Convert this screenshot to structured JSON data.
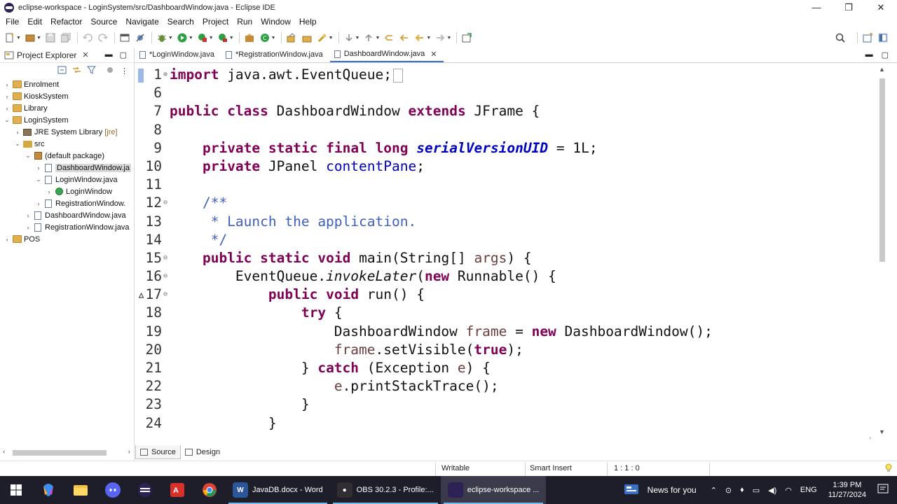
{
  "window": {
    "title": "eclipse-workspace - LoginSystem/src/DashboardWindow.java - Eclipse IDE",
    "minimize": "—",
    "maximize": "❐",
    "close": "✕"
  },
  "menu": [
    "File",
    "Edit",
    "Refactor",
    "Source",
    "Navigate",
    "Search",
    "Project",
    "Run",
    "Window",
    "Help"
  ],
  "explorer": {
    "title": "Project Explorer",
    "tree": [
      {
        "label": "Enrolment",
        "depth": 0,
        "arrow": "›",
        "icon": "project"
      },
      {
        "label": "KioskSystem",
        "depth": 0,
        "arrow": "›",
        "icon": "project"
      },
      {
        "label": "Library",
        "depth": 0,
        "arrow": "›",
        "icon": "project"
      },
      {
        "label": "LoginSystem",
        "depth": 0,
        "arrow": "⌄",
        "icon": "project"
      },
      {
        "label": "JRE System Library",
        "tag": "[jre]",
        "depth": 1,
        "arrow": "›",
        "icon": "jre"
      },
      {
        "label": "src",
        "depth": 1,
        "arrow": "⌄",
        "icon": "folder"
      },
      {
        "label": "(default package)",
        "depth": 2,
        "arrow": "⌄",
        "icon": "package"
      },
      {
        "label": "DashboardWindow.ja",
        "depth": 3,
        "arrow": "›",
        "icon": "java",
        "selected": true
      },
      {
        "label": "LoginWindow.java",
        "depth": 3,
        "arrow": "⌄",
        "icon": "java"
      },
      {
        "label": "LoginWindow",
        "depth": 4,
        "arrow": "›",
        "icon": "class"
      },
      {
        "label": "RegistrationWindow.",
        "depth": 3,
        "arrow": "›",
        "icon": "java"
      },
      {
        "label": "DashboardWindow.java",
        "depth": 2,
        "arrow": "›",
        "icon": "java"
      },
      {
        "label": "RegistrationWindow.java",
        "depth": 2,
        "arrow": "›",
        "icon": "java"
      },
      {
        "label": "POS",
        "depth": 0,
        "arrow": "›",
        "icon": "project"
      }
    ]
  },
  "editor": {
    "tabs": [
      {
        "label": "*LoginWindow.java",
        "active": false
      },
      {
        "label": "*RegistrationWindow.java",
        "active": false
      },
      {
        "label": "DashboardWindow.java",
        "active": true
      }
    ],
    "lines": [
      {
        "n": "1",
        "fold": "⊕",
        "tokens": [
          {
            "t": "import",
            "c": "kw"
          },
          {
            "t": " java.awt.EventQueue;",
            "c": ""
          }
        ],
        "caret": true
      },
      {
        "n": "6",
        "fold": "",
        "tokens": []
      },
      {
        "n": "7",
        "fold": "",
        "tokens": [
          {
            "t": "public",
            "c": "kw"
          },
          {
            "t": " ",
            "c": ""
          },
          {
            "t": "class",
            "c": "kw"
          },
          {
            "t": " DashboardWindow ",
            "c": ""
          },
          {
            "t": "extends",
            "c": "kw"
          },
          {
            "t": " JFrame {",
            "c": ""
          }
        ]
      },
      {
        "n": "8",
        "fold": "",
        "tokens": []
      },
      {
        "n": "9",
        "fold": "",
        "tokens": [
          {
            "t": "    ",
            "c": ""
          },
          {
            "t": "private",
            "c": "kw"
          },
          {
            "t": " ",
            "c": ""
          },
          {
            "t": "static",
            "c": "kw"
          },
          {
            "t": " ",
            "c": ""
          },
          {
            "t": "final",
            "c": "kw"
          },
          {
            "t": " ",
            "c": ""
          },
          {
            "t": "long",
            "c": "kw"
          },
          {
            "t": " ",
            "c": ""
          },
          {
            "t": "serialVersionUID",
            "c": "sfld"
          },
          {
            "t": " = 1L;",
            "c": ""
          }
        ]
      },
      {
        "n": "10",
        "fold": "",
        "tokens": [
          {
            "t": "    ",
            "c": ""
          },
          {
            "t": "private",
            "c": "kw"
          },
          {
            "t": " JPanel ",
            "c": ""
          },
          {
            "t": "contentPane",
            "c": "fld"
          },
          {
            "t": ";",
            "c": ""
          }
        ]
      },
      {
        "n": "11",
        "fold": "",
        "tokens": []
      },
      {
        "n": "12",
        "fold": "⊖",
        "tokens": [
          {
            "t": "    /**",
            "c": "cm"
          }
        ]
      },
      {
        "n": "13",
        "fold": "",
        "tokens": [
          {
            "t": "     * Launch the application.",
            "c": "cm"
          }
        ]
      },
      {
        "n": "14",
        "fold": "",
        "tokens": [
          {
            "t": "     */",
            "c": "cm"
          }
        ]
      },
      {
        "n": "15",
        "fold": "⊖",
        "tokens": [
          {
            "t": "    ",
            "c": ""
          },
          {
            "t": "public",
            "c": "kw"
          },
          {
            "t": " ",
            "c": ""
          },
          {
            "t": "static",
            "c": "kw"
          },
          {
            "t": " ",
            "c": ""
          },
          {
            "t": "void",
            "c": "kw"
          },
          {
            "t": " main(String[] ",
            "c": ""
          },
          {
            "t": "args",
            "c": "loc"
          },
          {
            "t": ") {",
            "c": ""
          }
        ]
      },
      {
        "n": "16",
        "fold": "⊖",
        "tokens": [
          {
            "t": "        EventQueue.",
            "c": ""
          },
          {
            "t": "invokeLater",
            "c": "it"
          },
          {
            "t": "(",
            "c": ""
          },
          {
            "t": "new",
            "c": "kw"
          },
          {
            "t": " Runnable() {",
            "c": ""
          }
        ]
      },
      {
        "n": "▵17",
        "fold": "⊖",
        "tokens": [
          {
            "t": "            ",
            "c": ""
          },
          {
            "t": "public",
            "c": "kw"
          },
          {
            "t": " ",
            "c": ""
          },
          {
            "t": "void",
            "c": "kw"
          },
          {
            "t": " run() {",
            "c": ""
          }
        ]
      },
      {
        "n": "18",
        "fold": "",
        "tokens": [
          {
            "t": "                ",
            "c": ""
          },
          {
            "t": "try",
            "c": "kw"
          },
          {
            "t": " {",
            "c": ""
          }
        ]
      },
      {
        "n": "19",
        "fold": "",
        "tokens": [
          {
            "t": "                    DashboardWindow ",
            "c": ""
          },
          {
            "t": "frame",
            "c": "loc"
          },
          {
            "t": " = ",
            "c": ""
          },
          {
            "t": "new",
            "c": "kw"
          },
          {
            "t": " DashboardWindow();",
            "c": ""
          }
        ]
      },
      {
        "n": "20",
        "fold": "",
        "tokens": [
          {
            "t": "                    ",
            "c": ""
          },
          {
            "t": "frame",
            "c": "loc"
          },
          {
            "t": ".setVisible(",
            "c": ""
          },
          {
            "t": "true",
            "c": "kw"
          },
          {
            "t": ");",
            "c": ""
          }
        ]
      },
      {
        "n": "21",
        "fold": "",
        "tokens": [
          {
            "t": "                } ",
            "c": ""
          },
          {
            "t": "catch",
            "c": "kw"
          },
          {
            "t": " (Exception ",
            "c": ""
          },
          {
            "t": "e",
            "c": "loc"
          },
          {
            "t": ") {",
            "c": ""
          }
        ]
      },
      {
        "n": "22",
        "fold": "",
        "tokens": [
          {
            "t": "                    ",
            "c": ""
          },
          {
            "t": "e",
            "c": "loc"
          },
          {
            "t": ".printStackTrace();",
            "c": ""
          }
        ]
      },
      {
        "n": "23",
        "fold": "",
        "tokens": [
          {
            "t": "                }",
            "c": ""
          }
        ]
      },
      {
        "n": "24",
        "fold": "",
        "tokens": [
          {
            "t": "            }",
            "c": ""
          }
        ]
      }
    ]
  },
  "bottom_tabs": [
    {
      "label": "Source",
      "active": true
    },
    {
      "label": "Design",
      "active": false
    }
  ],
  "status": {
    "writable": "Writable",
    "insert_mode": "Smart Insert",
    "position": "1 : 1 : 0"
  },
  "taskbar": {
    "apps": [
      {
        "label": "JavaDB.docx - Word",
        "icon_text": "W",
        "icon_color": "#2b579a",
        "active": false
      },
      {
        "label": "OBS 30.2.3 - Profile:...",
        "icon_text": "●",
        "icon_color": "#302e31",
        "active": false
      },
      {
        "label": "eclipse-workspace ...",
        "icon_text": "",
        "icon_color": "#2c2255",
        "active": true
      }
    ],
    "news": "News for you",
    "lang": "ENG",
    "time": "1:39 PM",
    "date": "11/27/2024"
  },
  "colors": {
    "keyword": "#7f0055",
    "field": "#0000c0",
    "comment": "#3f5fbf",
    "active_tab": "#2f6fd6",
    "taskbar": "#1e1e2b"
  }
}
